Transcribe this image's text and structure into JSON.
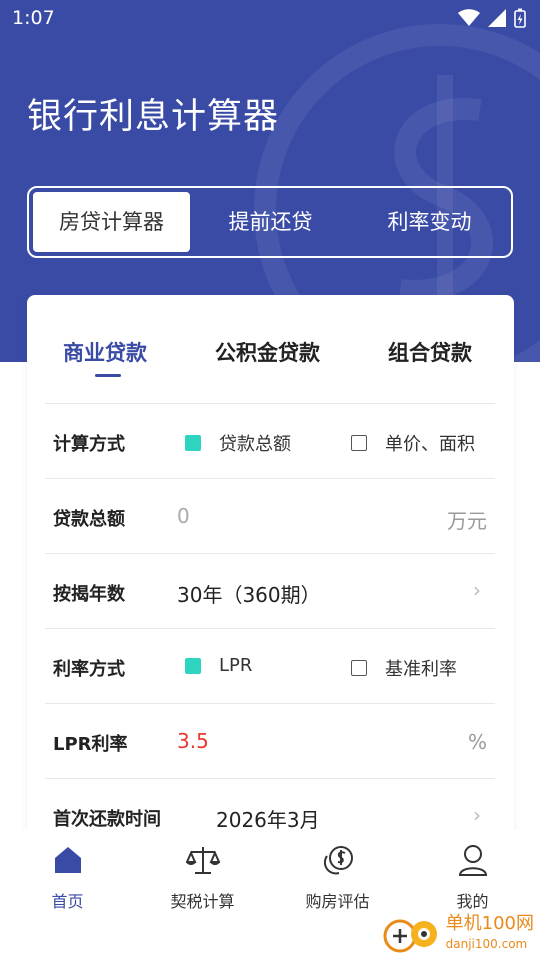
{
  "status": {
    "time": "1:07"
  },
  "app_title": "银行利息计算器",
  "segments": [
    "房贷计算器",
    "提前还贷",
    "利率变动"
  ],
  "loan_tabs": [
    "商业贷款",
    "公积金贷款",
    "组合贷款"
  ],
  "form": {
    "calc_method": {
      "label": "计算方式",
      "opt1": "贷款总额",
      "opt2": "单价、面积"
    },
    "loan_total": {
      "label": "贷款总额",
      "placeholder": "0",
      "unit": "万元"
    },
    "years": {
      "label": "按揭年数",
      "value": "30年（360期）"
    },
    "rate_method": {
      "label": "利率方式",
      "opt1": "LPR",
      "opt2": "基准利率"
    },
    "lpr": {
      "label": "LPR利率",
      "value": "3.5",
      "unit": "%"
    },
    "first_payment": {
      "label": "首次还款时间",
      "value": "2026年3月"
    }
  },
  "tabbar": [
    "首页",
    "契税计算",
    "购房评估",
    "我的"
  ],
  "watermark": {
    "title": "单机100网",
    "url": "danji100.com"
  },
  "colors": {
    "primary": "#3a4ba6",
    "accent": "#2ed4c0",
    "rate": "#e8392f"
  }
}
